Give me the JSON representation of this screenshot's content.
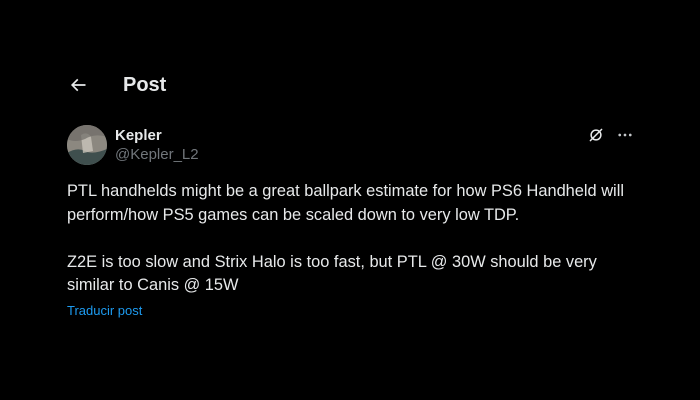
{
  "header": {
    "title": "Post"
  },
  "post": {
    "author": {
      "name": "Kepler",
      "handle": "@Kepler_L2"
    },
    "paragraphs": [
      "PTL handhelds might be a great ballpark estimate for how PS6 Handheld will perform/how PS5 games can be scaled down to very low TDP.",
      "Z2E is too slow and Strix Halo is too fast, but PTL @ 30W should be very similar to Canis @ 15W"
    ],
    "translate_label": "Traducir post"
  },
  "icons": {
    "back": "back-arrow-icon",
    "grok": "grok-icon",
    "more": "more-icon"
  },
  "colors": {
    "background": "#000000",
    "text": "#e7e9ea",
    "muted": "#71767b",
    "link": "#1d9bf0"
  }
}
